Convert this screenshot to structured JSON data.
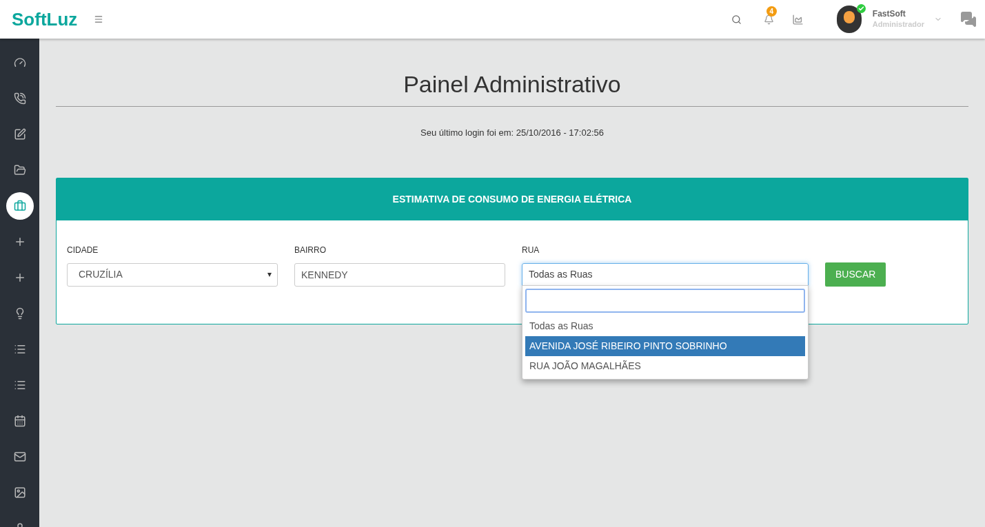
{
  "header": {
    "logo": "SoftLuz",
    "notifications": "4",
    "user": {
      "name": "FastSoft",
      "role": "Administrador",
      "online": true
    }
  },
  "sidebar": {
    "items": [
      {
        "selected": false
      },
      {
        "selected": false
      },
      {
        "selected": false
      },
      {
        "selected": false
      },
      {
        "selected": true
      },
      {
        "selected": false
      },
      {
        "selected": false
      },
      {
        "selected": false
      },
      {
        "selected": false
      },
      {
        "selected": false
      },
      {
        "selected": false
      },
      {
        "selected": false
      },
      {
        "selected": false
      },
      {
        "selected": false
      }
    ]
  },
  "page": {
    "title": "Painel Administrativo",
    "last_login": "Seu último login foi em: 25/10/2016 - 17:02:56"
  },
  "card": {
    "title": "ESTIMATIVA DE CONSUMO DE ENERGIA ELÉTRICA",
    "fields": [
      {
        "kind": "select",
        "label": "CIDADE",
        "value": "CRUZÍLIA"
      },
      {
        "kind": "text",
        "label": "BAIRRO",
        "value": "KENNEDY"
      },
      {
        "kind": "combobox",
        "label": "RUA",
        "value": "Todas as Ruas",
        "expanded": true,
        "options": [
          {
            "label": "Todas as Ruas",
            "highlighted": false
          },
          {
            "label": "AVENIDA JOSÉ RIBEIRO PINTO SOBRINHO",
            "highlighted": true
          },
          {
            "label": "RUA JOÃO MAGALHÃES",
            "highlighted": false
          }
        ]
      }
    ],
    "button": "BUSCAR"
  }
}
